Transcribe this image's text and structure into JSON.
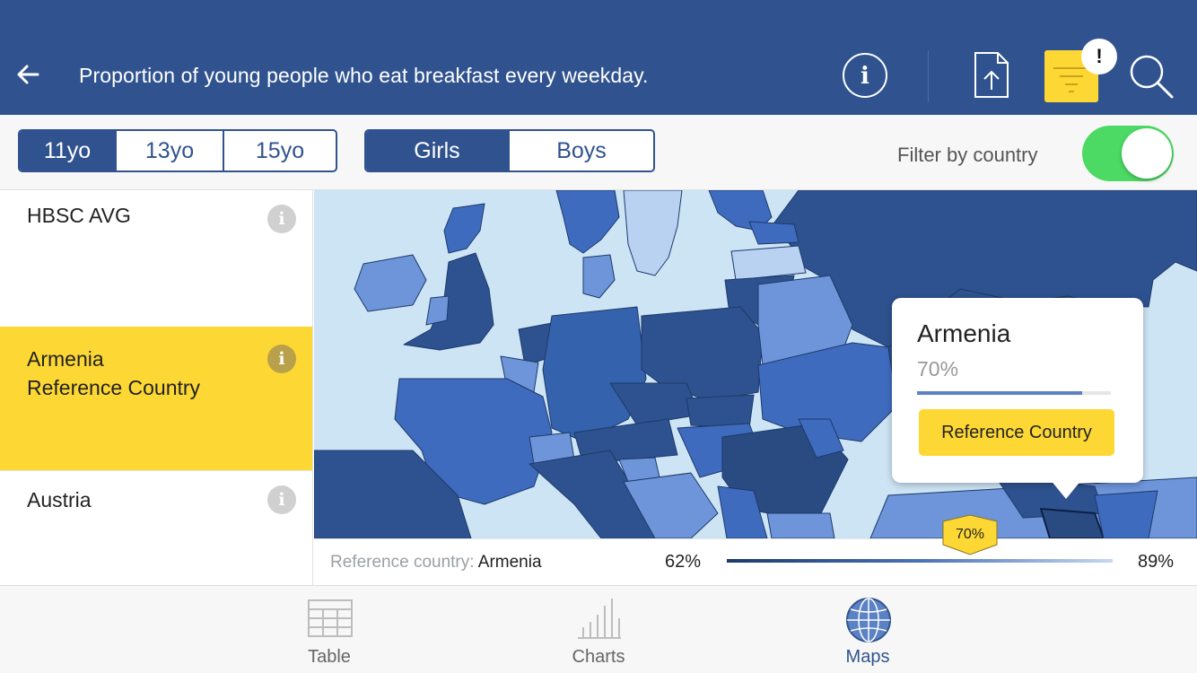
{
  "header": {
    "title": "Proportion of young people who eat breakfast every weekday.",
    "filter_badge": "!",
    "icons": [
      "back-arrow-icon",
      "info-icon",
      "share-icon",
      "filter-icon",
      "search-icon"
    ]
  },
  "filters": {
    "ages": [
      {
        "label": "11yo",
        "active": true
      },
      {
        "label": "13yo",
        "active": false
      },
      {
        "label": "15yo",
        "active": false
      }
    ],
    "genders": [
      {
        "label": "Girls",
        "active": true
      },
      {
        "label": "Boys",
        "active": false
      }
    ],
    "filter_by_country_label": "Filter by country",
    "filter_by_country_on": true
  },
  "list": {
    "items": [
      {
        "name": "HBSC AVG",
        "selected": false
      },
      {
        "name": "Armenia",
        "subtitle": "Reference Country",
        "selected": true
      },
      {
        "name": "Austria",
        "selected": false
      }
    ]
  },
  "tooltip": {
    "country": "Armenia",
    "value": "70%",
    "fraction": 0.85,
    "button": "Reference Country"
  },
  "legend": {
    "label": "Reference country:",
    "country": "Armenia",
    "min": "62%",
    "max": "89%",
    "marker": "70%"
  },
  "tabs": [
    {
      "label": "Table",
      "active": false
    },
    {
      "label": "Charts",
      "active": false
    },
    {
      "label": "Maps",
      "active": true
    }
  ],
  "colors": {
    "header_bg": "#30538f",
    "accent_yellow": "#fdd835",
    "toggle_on": "#4cd964",
    "map_water": "#cde4f5"
  }
}
